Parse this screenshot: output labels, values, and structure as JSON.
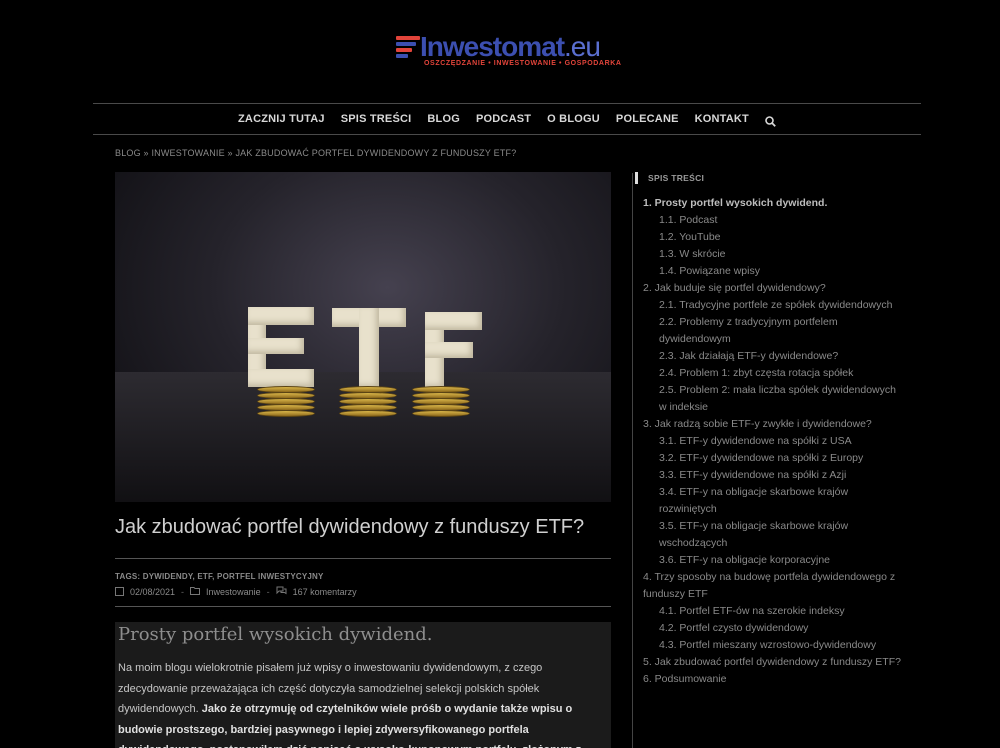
{
  "brand": {
    "name": "Inwestomat",
    "tld": ".eu",
    "tagline": "OSZCZĘDZANIE • INWESTOWANIE • GOSPODARKA",
    "colors": {
      "primary": "#3c4fb0",
      "accent": "#e2443a"
    }
  },
  "nav": {
    "items": [
      "ZACZNIJ TUTAJ",
      "SPIS TREŚCI",
      "BLOG",
      "PODCAST",
      "O BLOGU",
      "POLECANE",
      "KONTAKT"
    ],
    "search_icon": "search-icon"
  },
  "breadcrumb": {
    "items": [
      "BLOG",
      "INWESTOWANIE",
      "JAK ZBUDOWAĆ PORTFEL DYWIDENDOWY Z FUNDUSZY ETF?"
    ],
    "separator": "»"
  },
  "post": {
    "title": "Jak zbudować portfel dywidendowy z funduszy ETF?",
    "tags": "TAGS: DYWIDENDY, ETF, PORTFEL INWESTYCYJNY",
    "date": "02/08/2021",
    "category": "Inwestowanie",
    "comments": "167 komentarzy",
    "hero_letters": "ETF"
  },
  "content": {
    "heading": "Prosty portfel wysokich dywidend.",
    "para_normal": "Na moim blogu wielokrotnie pisałem już wpisy o inwestowaniu dywidendowym, z czego zdecydowanie przeważająca ich część dotyczyła samodzielnej selekcji polskich spółek dywidendowych. ",
    "para_bold": "Jako że otrzymuję od czytelników wiele próśb o wydanie także wpisu o budowie prostszego, bardziej pasywnego i lepiej zdywersyfikowanego portfela dywidendowego, postanowiłem dziś napisać o wysoko-kuponowym portfelu, złożonym z"
  },
  "toc": {
    "heading": "SPIS TREŚCI",
    "items": [
      {
        "label": "1. Prosty portfel wysokich dywidend.",
        "level": 1
      },
      {
        "label": "1.1. Podcast",
        "level": 2
      },
      {
        "label": "1.2. YouTube",
        "level": 2
      },
      {
        "label": "1.3. W skrócie",
        "level": 2
      },
      {
        "label": "1.4. Powiązane wpisy",
        "level": 2
      },
      {
        "label": "2. Jak buduje się portfel dywidendowy?",
        "level": 1
      },
      {
        "label": "2.1. Tradycyjne portfele ze spółek dywidendowych",
        "level": 2
      },
      {
        "label": "2.2. Problemy z tradycyjnym portfelem dywidendowym",
        "level": 2
      },
      {
        "label": "2.3. Jak działają ETF-y dywidendowe?",
        "level": 2
      },
      {
        "label": "2.4. Problem 1: zbyt częsta rotacja spółek",
        "level": 2
      },
      {
        "label": "2.5. Problem 2: mała liczba spółek dywidendowych w indeksie",
        "level": 2
      },
      {
        "label": "3. Jak radzą sobie ETF-y zwykłe i dywidendowe?",
        "level": 1
      },
      {
        "label": "3.1. ETF-y dywidendowe na spółki z USA",
        "level": 2
      },
      {
        "label": "3.2. ETF-y dywidendowe na spółki z Europy",
        "level": 2
      },
      {
        "label": "3.3. ETF-y dywidendowe na spółki z Azji",
        "level": 2
      },
      {
        "label": "3.4. ETF-y na obligacje skarbowe krajów rozwiniętych",
        "level": 2
      },
      {
        "label": "3.5. ETF-y na obligacje skarbowe krajów wschodzących",
        "level": 2
      },
      {
        "label": "3.6. ETF-y na obligacje korporacyjne",
        "level": 2
      },
      {
        "label": "4. Trzy sposoby na budowę portfela dywidendowego z funduszy ETF",
        "level": 1
      },
      {
        "label": "4.1. Portfel ETF-ów na szerokie indeksy",
        "level": 2
      },
      {
        "label": "4.2. Portfel czysto dywidendowy",
        "level": 2
      },
      {
        "label": "4.3. Portfel mieszany wzrostowo-dywidendowy",
        "level": 2
      },
      {
        "label": "5. Jak zbudować portfel dywidendowy z funduszy ETF?",
        "level": 1
      },
      {
        "label": "6. Podsumowanie",
        "level": 1
      }
    ]
  }
}
